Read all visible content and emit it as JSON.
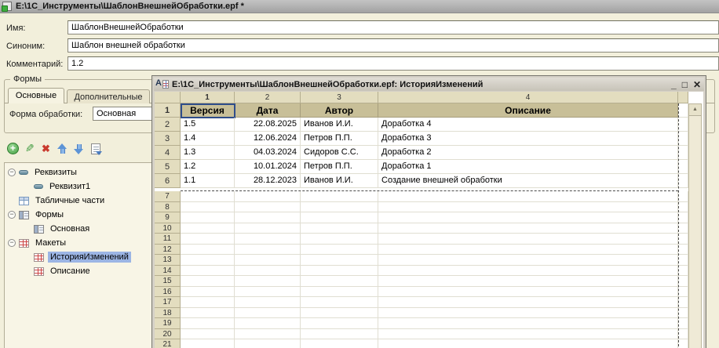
{
  "main_window": {
    "title": "E:\\1C_Инструменты\\ШаблонВнешнейОбработки.epf *",
    "fields": [
      {
        "label": "Имя:",
        "value": "ШаблонВнешнейОбработки"
      },
      {
        "label": "Синоним:",
        "value": "Шаблон внешней обработки"
      },
      {
        "label": "Комментарий:",
        "value": "1.2"
      }
    ],
    "forms_group": {
      "title": "Формы",
      "tab_active": "Основные",
      "tab_inactive": "Дополнительные",
      "form_field_label": "Форма обработки:",
      "form_field_value": "Основная"
    },
    "toolbar": [
      {
        "name": "add"
      },
      {
        "name": "edit"
      },
      {
        "name": "delete"
      },
      {
        "name": "move-up"
      },
      {
        "name": "move-down"
      },
      {
        "name": "reorder"
      }
    ],
    "tree": [
      {
        "label": "Реквизиты",
        "level": 1,
        "expander": true,
        "icon": "attribute",
        "selected": false
      },
      {
        "label": "Реквизит1",
        "level": 2,
        "expander": false,
        "icon": "attribute",
        "selected": false
      },
      {
        "label": "Табличные части",
        "level": 1,
        "expander": false,
        "icon": "tabular",
        "selected": false
      },
      {
        "label": "Формы",
        "level": 1,
        "expander": true,
        "icon": "form",
        "selected": false
      },
      {
        "label": "Основная",
        "level": 2,
        "expander": false,
        "icon": "form",
        "selected": false
      },
      {
        "label": "Макеты",
        "level": 1,
        "expander": true,
        "icon": "layout",
        "selected": false
      },
      {
        "label": "ИсторияИзменений",
        "level": 2,
        "expander": false,
        "icon": "layout",
        "selected": true
      },
      {
        "label": "Описание",
        "level": 2,
        "expander": false,
        "icon": "layout",
        "selected": false
      }
    ]
  },
  "sheet_window": {
    "title": "E:\\1C_Инструменты\\ШаблонВнешнейОбработки.epf: ИсторияИзменений",
    "window_controls": {
      "minimize": "_",
      "maximize": "□",
      "close": "✕"
    },
    "scroll_up_glyph": "▲",
    "column_strip": [
      "1",
      "2",
      "3",
      "4"
    ],
    "header_row_number": "1",
    "header_row": [
      "Версия",
      "Дата",
      "Автор",
      "Описание"
    ],
    "rows": [
      {
        "num": "2",
        "cells": [
          "1.5",
          "22.08.2025",
          "Иванов И.И.",
          "Доработка 4"
        ]
      },
      {
        "num": "3",
        "cells": [
          "1.4",
          "12.06.2024",
          "Петров П.П.",
          "Доработка 3"
        ]
      },
      {
        "num": "4",
        "cells": [
          "1.3",
          "04.03.2024",
          "Сидоров С.С.",
          "Доработка 2"
        ]
      },
      {
        "num": "5",
        "cells": [
          "1.2",
          "10.01.2024",
          "Петров П.П.",
          "Доработка 1"
        ]
      },
      {
        "num": "6",
        "cells": [
          "1.1",
          "28.12.2023",
          "Иванов И.И.",
          "Создание внешней обработки"
        ]
      }
    ],
    "empty_row_numbers": [
      "7",
      "8",
      "9",
      "10",
      "11",
      "12",
      "13",
      "14",
      "15",
      "16",
      "17",
      "18",
      "19",
      "20",
      "21"
    ]
  },
  "colors": {
    "page_bg": "#f2efdb",
    "sheet_header_bg": "#c8bf98",
    "row_header_bg": "#e3ddbf",
    "tree_selection": "#9cb5e4",
    "cell_selection_border": "#2f4d8a"
  }
}
